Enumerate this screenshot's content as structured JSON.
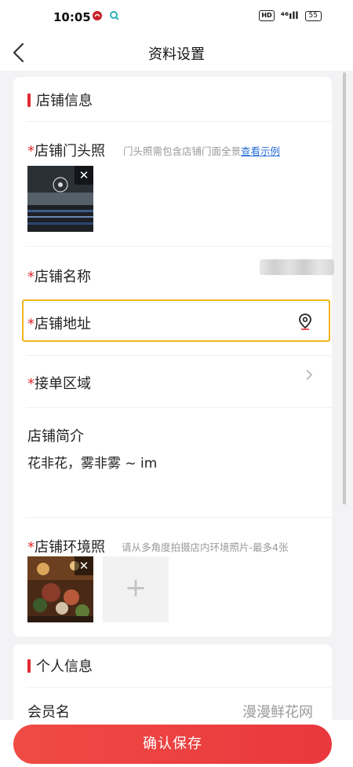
{
  "status": {
    "time": "10:05",
    "hd": "HD",
    "network": "⁴⁶ıll",
    "battery": "55"
  },
  "nav": {
    "title": "资料设置"
  },
  "shop_section": {
    "title": "店铺信息",
    "storefront": {
      "required": "*",
      "label": "店铺门头照",
      "hint": "门头照需包含店铺门面全景",
      "example_link": "查看示例"
    },
    "shop_name": {
      "required": "*",
      "label": "店铺名称"
    },
    "shop_address": {
      "required": "*",
      "label": "店铺地址"
    },
    "order_area": {
      "required": "*",
      "label": "接单区域"
    },
    "intro": {
      "label": "店铺简介",
      "value": "花非花，雾非雾 ~ im"
    },
    "environment": {
      "required": "*",
      "label": "店铺环境照",
      "hint": "请从多角度拍摄店内环境照片-最多4张",
      "add_symbol": "+"
    },
    "remove_symbol": "✕"
  },
  "personal_section": {
    "title": "个人信息",
    "member": {
      "label": "会员名",
      "value": "漫漫鲜花网"
    }
  },
  "actions": {
    "save_label": "确认保存"
  },
  "colors": {
    "accent": "#e12a31",
    "highlight_border": "#f0b51d",
    "link": "#2a6fd6"
  }
}
